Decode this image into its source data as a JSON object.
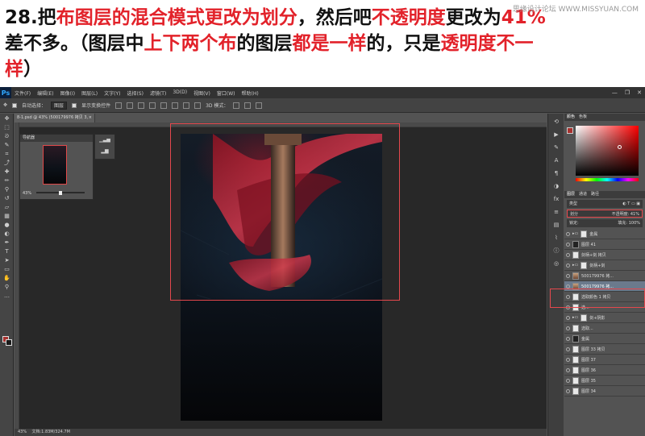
{
  "instruction": {
    "step": "28.",
    "line1_parts": [
      {
        "text": "把",
        "hl": false
      },
      {
        "text": "布图层的混合模式更改为划分",
        "hl": true
      },
      {
        "text": "，然后吧",
        "hl": false
      },
      {
        "text": "不透明度",
        "hl": true
      },
      {
        "text": "更改为",
        "hl": false
      },
      {
        "text": "41%",
        "hl": true
      }
    ],
    "line2_parts": [
      {
        "text": "差不多。（图层中",
        "hl": false
      },
      {
        "text": "上下两个布",
        "hl": true
      },
      {
        "text": "的图层",
        "hl": false
      },
      {
        "text": "都是一样",
        "hl": true
      },
      {
        "text": "的，只是",
        "hl": false
      },
      {
        "text": "透明度不一",
        "hl": true
      }
    ],
    "line3_parts": [
      {
        "text": "样",
        "hl": true
      },
      {
        "text": "）",
        "hl": false
      }
    ],
    "highlight_color": "#e2222a",
    "watermark": "思缘设计论坛 WWW.MISSYUAN.COM"
  },
  "app": {
    "logo": "Ps",
    "menu": [
      "文件(F)",
      "编辑(E)",
      "图像(I)",
      "图层(L)",
      "文字(Y)",
      "选择(S)",
      "滤镜(T)",
      "3D(D)",
      "视图(V)",
      "窗口(W)",
      "帮助(H)"
    ],
    "window_controls": [
      "—",
      "❐",
      "✕"
    ]
  },
  "options_bar": {
    "auto_select_label": "自动选择：",
    "auto_select_value": "图层",
    "show_transform_label": "显示变换控件",
    "mode_3d_label": "3D 模式："
  },
  "document": {
    "tab_title": "8-1.psd @ 43% (500179976 拷贝 3, RGB/8)",
    "zoom": "43%",
    "status": "文档:1.83M/324.7M"
  },
  "navigator": {
    "title": "导航器",
    "zoom": "43%"
  },
  "color_panel": {
    "tabs": [
      "颜色",
      "色板"
    ],
    "foreground": "#a8322f"
  },
  "layers_panel": {
    "tabs": [
      "图层",
      "通道",
      "路径"
    ],
    "kind_filter": "类型",
    "blend_mode": "划分",
    "opacity_label": "不透明度:",
    "opacity_value": "41%",
    "lock_label": "锁定:",
    "fill_label": "填充:",
    "fill_value": "100%",
    "layers": [
      {
        "name": "金属",
        "type": "group"
      },
      {
        "name": "图层 41",
        "type": "masked"
      },
      {
        "name": "剑柄+剑 拷贝",
        "type": "layer"
      },
      {
        "name": "剑柄+剑",
        "type": "group"
      },
      {
        "name": "500179976 拷...",
        "type": "photo"
      },
      {
        "name": "500179976 拷...",
        "type": "photo",
        "selected": true
      },
      {
        "name": "选取颜色 1 拷贝",
        "type": "adjust"
      },
      {
        "name": "选...",
        "type": "adjust"
      },
      {
        "name": "剑+阴影",
        "type": "group"
      },
      {
        "name": "选取...",
        "type": "adjust"
      },
      {
        "name": "金属",
        "type": "masked"
      },
      {
        "name": "图层 33 拷贝",
        "type": "layer"
      },
      {
        "name": "图层 37",
        "type": "layer"
      },
      {
        "name": "图层 36",
        "type": "layer"
      },
      {
        "name": "图层 35",
        "type": "layer"
      },
      {
        "name": "图层 34",
        "type": "layer"
      }
    ]
  },
  "annotation_color": "#e5484d"
}
